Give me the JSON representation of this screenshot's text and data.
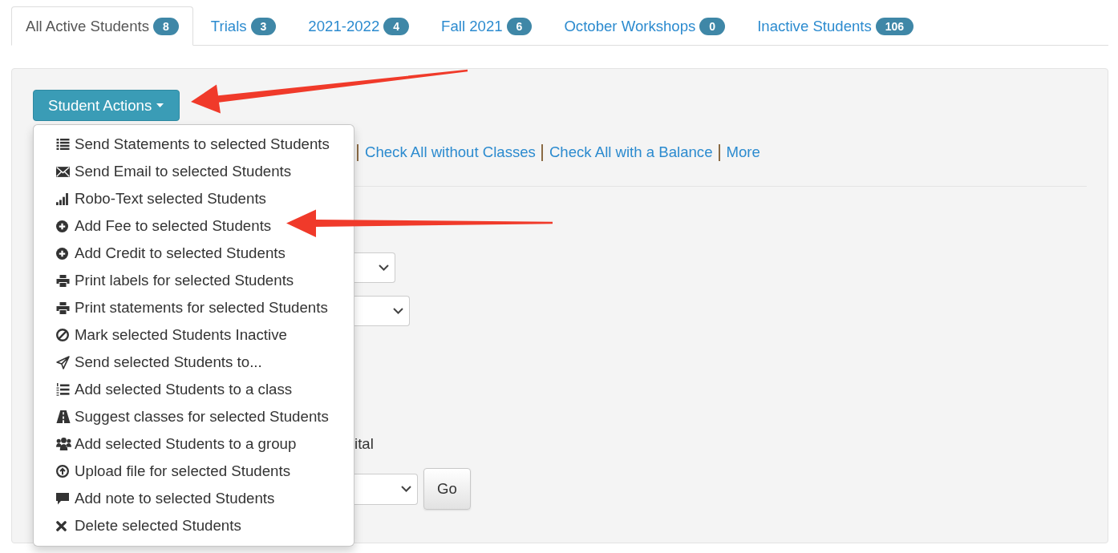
{
  "tabs": [
    {
      "label": "All Active Students",
      "count": "8",
      "selected": true
    },
    {
      "label": "Trials",
      "count": "3",
      "selected": false
    },
    {
      "label": "2021-2022",
      "count": "4",
      "selected": false
    },
    {
      "label": "Fall 2021",
      "count": "6",
      "selected": false
    },
    {
      "label": "October Workshops",
      "count": "0",
      "selected": false
    },
    {
      "label": "Inactive Students",
      "count": "106",
      "selected": false
    }
  ],
  "actions_button": {
    "label": "Student Actions",
    "expanded": true
  },
  "actions_menu": {
    "items": [
      {
        "kind": "statements",
        "label": "Send Statements to selected Students"
      },
      {
        "kind": "email",
        "label": "Send Email to selected Students"
      },
      {
        "kind": "robotext",
        "label": "Robo-Text selected Students"
      },
      {
        "kind": "fee",
        "label": "Add Fee to selected Students"
      },
      {
        "kind": "credit",
        "label": "Add Credit to selected Students"
      },
      {
        "kind": "labels",
        "label": "Print labels for selected Students"
      },
      {
        "kind": "print",
        "label": "Print statements for selected Students"
      },
      {
        "kind": "inactive",
        "label": "Mark selected Students Inactive"
      },
      {
        "kind": "send",
        "label": "Send selected Students to..."
      },
      {
        "kind": "class",
        "label": "Add selected Students to a class"
      },
      {
        "kind": "suggest",
        "label": "Suggest classes for selected Students"
      },
      {
        "kind": "group",
        "label": "Add selected Students to a group"
      },
      {
        "kind": "upload",
        "label": "Upload file for selected Students"
      },
      {
        "kind": "note",
        "label": "Add note to selected Students"
      },
      {
        "kind": "delete",
        "label": "Delete selected Students"
      }
    ]
  },
  "panel": {
    "links": [
      "Check All without Classes",
      "Check All with a Balance",
      "More"
    ],
    "partial_label": "ital",
    "go_button": "Go"
  }
}
